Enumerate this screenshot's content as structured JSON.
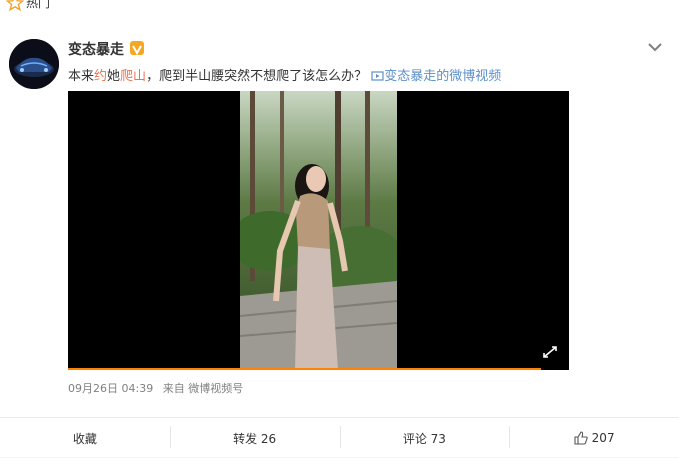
{
  "topbar": {
    "section_label": "热门"
  },
  "post": {
    "username": "变态暴走",
    "text": {
      "prefix": "本来",
      "hl1": "约",
      "mid1": "她",
      "hl2": "爬山",
      "rest": "，爬到半山腰突然不想爬了该怎么办？",
      "link_icon": "video-link-icon",
      "link_text": "变态暴走的微博视频"
    },
    "video": {
      "progress": 0.944
    },
    "meta": {
      "time": "09月26日 04:39",
      "source": "来自 微博视频号"
    }
  },
  "actions": {
    "favorite": "收藏",
    "repost": "转发 26",
    "comment": "评论 73",
    "like": "207"
  },
  "colors": {
    "accent": "#ff8200",
    "link": "#5d8fc9",
    "highlight": "#eb7350"
  }
}
